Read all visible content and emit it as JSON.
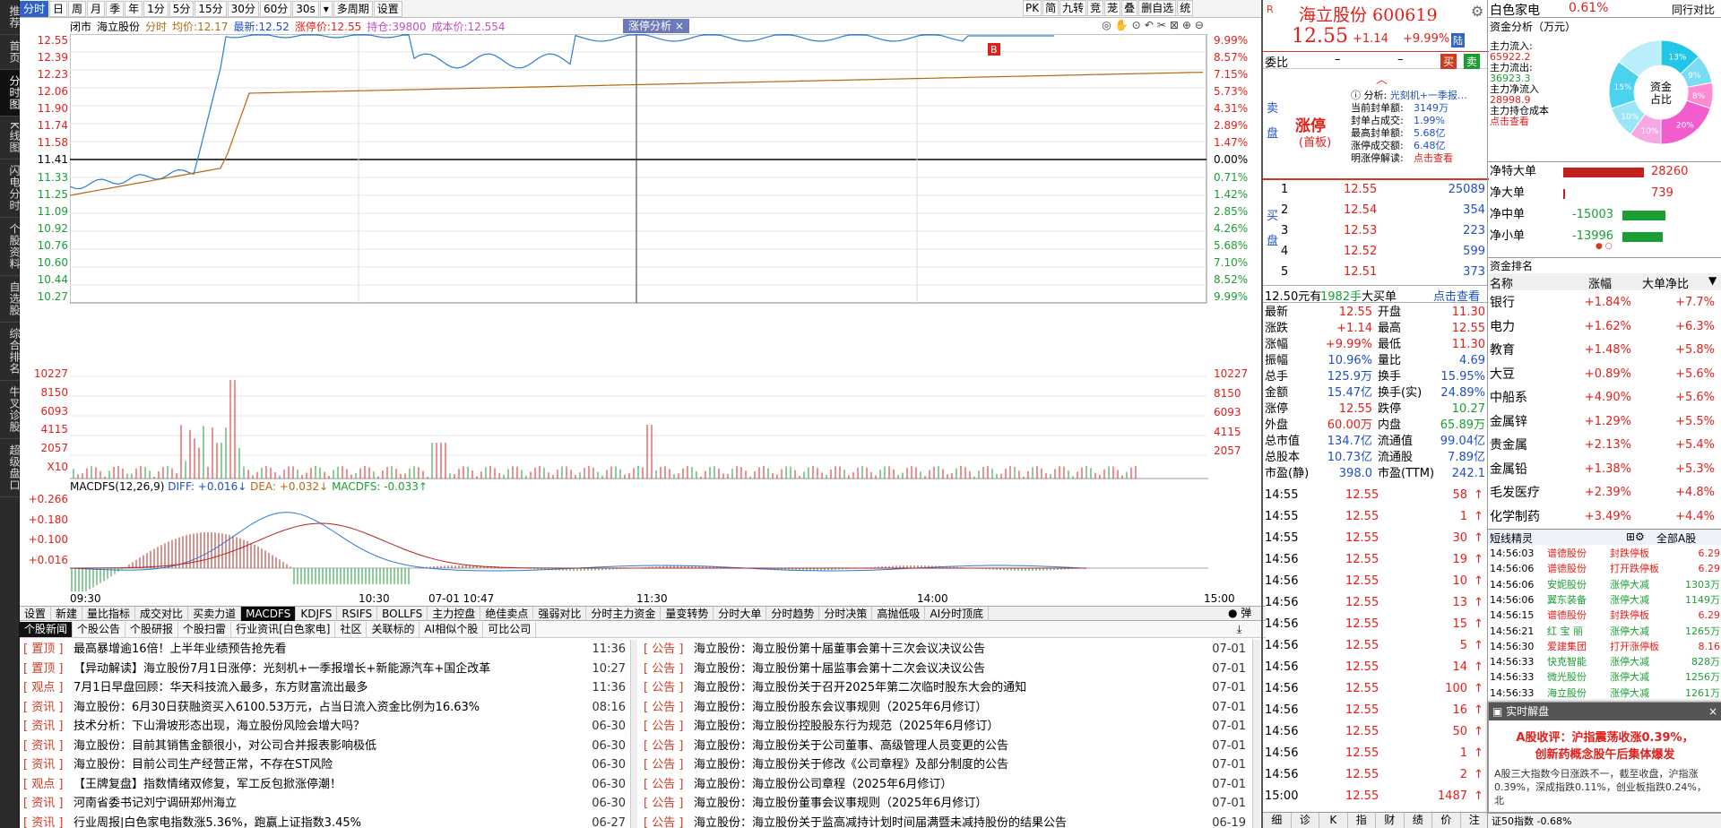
{
  "rail": [
    "推荐",
    "首页",
    "分时图",
    "K线图",
    "闪电分时",
    "个股资料",
    "自选股",
    "综合排名",
    "牛叉诊股",
    "超级盘口"
  ],
  "toolbar": {
    "periods": [
      "分时",
      "日",
      "周",
      "月",
      "季",
      "年",
      "1分",
      "5分",
      "15分",
      "30分",
      "60分",
      "30s"
    ],
    "extra": [
      "多周期",
      "设置"
    ],
    "right": [
      "PK",
      "简",
      "九转",
      "竞",
      "茏",
      "叠",
      "删自选",
      "统"
    ]
  },
  "chart": {
    "status": "闭市",
    "name": "海立股份",
    "time_label": "分时",
    "avg_label": "均价:",
    "avg": "12.17",
    "latest_label": "最新:",
    "latest": "12.52",
    "chg_label": "涨停价:",
    "chg": "12.55",
    "hold_label": "持仓:",
    "hold": "39800",
    "cost_label": "成本价:",
    "cost": "12.554",
    "zt_label": "涨停分析",
    "zt_close": "×",
    "priceAxisL": [
      "12.55",
      "12.39",
      "12.23",
      "12.06",
      "11.90",
      "11.74",
      "11.58",
      "11.41",
      "11.33",
      "11.25",
      "11.09",
      "10.92",
      "10.76",
      "10.60",
      "10.44",
      "10.27"
    ],
    "priceAxisR": [
      "9.99%",
      "8.57%",
      "7.15%",
      "5.73%",
      "4.31%",
      "2.89%",
      "1.47%",
      "0.00%",
      "0.71%",
      "1.42%",
      "2.85%",
      "4.26%",
      "5.68%",
      "7.10%",
      "8.52%",
      "9.99%"
    ],
    "volAxisL": [
      "10227",
      "8150",
      "6093",
      "4115",
      "2057",
      "X10"
    ],
    "volAxisR": [
      "10227",
      "8150",
      "6093",
      "4115",
      "2057"
    ],
    "macd_head": "MACDFS(12,26,9)",
    "diff": "DIFF: +0.016↓",
    "dea": "DEA: +0.032↓",
    "macdfs": "MACDFS: -0.033↑",
    "macdAxis": [
      "+0.266",
      "+0.180",
      "+0.100",
      "+0.016"
    ],
    "timeAxis": [
      "09:30",
      "10:30",
      "07-01 10:47",
      "11:30",
      "14:00",
      "15:00"
    ],
    "marker": "B"
  },
  "indTabs": [
    "设置",
    "新建",
    "量比指标",
    "成交对比",
    "买卖力道",
    "MACDFS",
    "KDJFS",
    "RSIFS",
    "BOLLFS",
    "主力控盘",
    "绝佳卖点",
    "强弱对比",
    "分时主力资金",
    "量变转势",
    "分时大单",
    "分时趋势",
    "分时决策",
    "高抛低吸",
    "AI分时顶底"
  ],
  "indActive": "MACDFS",
  "bullet": "弹",
  "newsTabs": [
    "个股新闻",
    "个股公告",
    "个股研报",
    "个股扫雷",
    "行业资讯[白色家电]",
    "社区",
    "关联标的",
    "AI相似个股",
    "可比公司"
  ],
  "newsLeft": [
    [
      "置顶",
      "最高暴增逾16倍！上半年业绩预告抢先看",
      "11:36"
    ],
    [
      "置顶",
      "【异动解读】海立股份7月1日涨停：光刻机+一季报增长+新能源汽车+国企改革",
      "10:27"
    ],
    [
      "观点",
      "7月1日早盘回顾：华天科技流入最多，东方财富流出最多",
      "11:36"
    ],
    [
      "资讯",
      "海立股份：6月30日获融资买入6100.53万元，占当日流入资金比例为16.63%",
      "08:16"
    ],
    [
      "资讯",
      "技术分析：下山滑坡形态出现，海立股份风险会增大吗？",
      "06-30"
    ],
    [
      "资讯",
      "海立股份：目前其销售金额很小，对公司合并报表影响极低",
      "06-30"
    ],
    [
      "资讯",
      "海立股份：目前公司生产经营正常，不存在ST风险",
      "06-30"
    ],
    [
      "观点",
      "【王牌复盘】指数情绪双修复，军工反包掀涨停潮！",
      "06-30"
    ],
    [
      "资讯",
      "河南省委书记刘宁调研郑州海立",
      "06-30"
    ],
    [
      "资讯",
      "行业周报|白色家电指数涨5.36%，跑赢上证指数3.45%",
      "06-27"
    ]
  ],
  "newsRight": [
    [
      "公告",
      "海立股份：海立股份第十届董事会第十三次会议决议公告",
      "07-01"
    ],
    [
      "公告",
      "海立股份：海立股份第十届监事会第十二次会议决议公告",
      "07-01"
    ],
    [
      "公告",
      "海立股份：海立股份关于召开2025年第二次临时股东大会的通知",
      "07-01"
    ],
    [
      "公告",
      "海立股份：海立股份股东会议事规则（2025年6月修订）",
      "07-01"
    ],
    [
      "公告",
      "海立股份：海立股份控股股东行为规范（2025年6月修订）",
      "07-01"
    ],
    [
      "公告",
      "海立股份：海立股份关于公司董事、高级管理人员变更的公告",
      "07-01"
    ],
    [
      "公告",
      "海立股份：海立股份关于修改《公司章程》及部分制度的公告",
      "07-01"
    ],
    [
      "公告",
      "海立股份：海立股份公司章程（2025年6月修订）",
      "07-01"
    ],
    [
      "公告",
      "海立股份：海立股份董事会议事规则（2025年6月修订）",
      "07-01"
    ],
    [
      "公告",
      "海立股份：海立股份关于监高减持计划时间届满暨未减持股份的结果公告",
      "06-19"
    ]
  ],
  "quote": {
    "title": "海立股份 600619",
    "price": "12.55",
    "change": "+1.14",
    "pct": "+9.99%",
    "tag": "陆",
    "r_tag": "R",
    "weibi_label": "委比",
    "weibi": "–",
    "weibi2": "–",
    "buy": "买",
    "sell": "卖",
    "sell_label": "卖盘",
    "buy_label": "买盘",
    "zhangting": "涨停",
    "shouban": "(首板)",
    "analysis_title": "分析:",
    "analysis": "光刻机+一季报…",
    "analysis_rows": [
      [
        "当前封单额:",
        "3149万"
      ],
      [
        "封单占成交:",
        "1.99%"
      ],
      [
        "最高封单额:",
        "5.68亿"
      ],
      [
        "涨停成交额:",
        "6.48亿"
      ],
      [
        "明涨停解读:",
        "点击查看"
      ]
    ],
    "bids": [
      [
        "1",
        "12.55",
        "25089"
      ],
      [
        "2",
        "12.54",
        "354"
      ],
      [
        "3",
        "12.53",
        "223"
      ],
      [
        "4",
        "12.52",
        "599"
      ],
      [
        "5",
        "12.51",
        "373"
      ]
    ],
    "big": "12.50元有",
    "bigv": "1982手",
    "bigt": "大买单",
    "bigl": "点击查看",
    "stats": [
      [
        "最新",
        "12.55",
        "开盘",
        "11.30"
      ],
      [
        "涨跌",
        "+1.14",
        "最高",
        "12.55"
      ],
      [
        "涨幅",
        "+9.99%",
        "最低",
        "11.30"
      ],
      [
        "振幅",
        "10.96%",
        "量比",
        "4.69"
      ],
      [
        "总手",
        "125.9万",
        "换手",
        "15.95%"
      ],
      [
        "金额",
        "15.47亿",
        "换手(实)",
        "24.89%"
      ],
      [
        "涨停",
        "12.55",
        "跌停",
        "10.27"
      ],
      [
        "外盘",
        "60.00万",
        "内盘",
        "65.89万"
      ],
      [
        "总市值",
        "134.7亿",
        "流通值",
        "99.04亿"
      ],
      [
        "总股本",
        "10.73亿",
        "流通股",
        "7.89亿"
      ],
      [
        "市盈(静)",
        "398.0",
        "市盈(TTM)",
        "242.1"
      ]
    ],
    "ticks": [
      [
        "14:55",
        "12.55",
        "58"
      ],
      [
        "14:55",
        "12.55",
        "1"
      ],
      [
        "14:55",
        "12.55",
        "30"
      ],
      [
        "14:56",
        "12.55",
        "19"
      ],
      [
        "14:56",
        "12.55",
        "10"
      ],
      [
        "14:56",
        "12.55",
        "13"
      ],
      [
        "14:56",
        "12.55",
        "15"
      ],
      [
        "14:56",
        "12.55",
        "5"
      ],
      [
        "14:56",
        "12.55",
        "14"
      ],
      [
        "14:56",
        "12.55",
        "100"
      ],
      [
        "14:56",
        "12.55",
        "16"
      ],
      [
        "14:56",
        "12.55",
        "50"
      ],
      [
        "14:56",
        "12.55",
        "1"
      ],
      [
        "14:56",
        "12.55",
        "2"
      ],
      [
        "15:00",
        "12.55",
        "1487"
      ]
    ],
    "bottom": [
      "细",
      "诊",
      "K",
      "指",
      "财",
      "绩",
      "价",
      "注"
    ]
  },
  "fr": {
    "sector": "白色家电",
    "sector_pct": "0.61%",
    "peer": "同行对比",
    "fund_title": "资金分析（万元）",
    "fund": [
      [
        "主力流入:",
        "65922.2"
      ],
      [
        "主力流出:",
        "36923.3"
      ],
      [
        "主力净流入",
        "28998.9"
      ],
      [
        "主力持仓成本",
        ""
      ],
      [
        "点击查看",
        ""
      ]
    ],
    "pie_center": "资金\n占比",
    "pie_labels": [
      "13%",
      "9%",
      "8%",
      "20%",
      "10%",
      "10%",
      "15%"
    ],
    "net": [
      [
        "净特大单",
        "28260"
      ],
      [
        "净大单",
        "739"
      ],
      [
        "净中单",
        "-15003"
      ],
      [
        "净小单",
        "-13996"
      ]
    ],
    "rank_title": "资金排名",
    "rank_head": [
      "名称",
      "涨幅",
      "大单净比"
    ],
    "rank": [
      [
        "银行",
        "+1.84%",
        "+7.7%"
      ],
      [
        "电力",
        "+1.62%",
        "+6.3%"
      ],
      [
        "教育",
        "+1.48%",
        "+5.8%"
      ],
      [
        "大豆",
        "+0.89%",
        "+5.6%"
      ],
      [
        "中船系",
        "+4.90%",
        "+5.6%"
      ],
      [
        "金属锌",
        "+1.29%",
        "+5.5%"
      ],
      [
        "贵金属",
        "+2.13%",
        "+5.4%"
      ],
      [
        "金属铅",
        "+1.38%",
        "+5.3%"
      ],
      [
        "毛发医疗",
        "+2.39%",
        "+4.8%"
      ],
      [
        "化学制药",
        "+3.49%",
        "+4.4%"
      ]
    ],
    "wizard_title": "短线精灵",
    "wizard_scope": "全部A股",
    "wizard": [
      [
        "14:56:03",
        "谱德股份",
        "封跌停板",
        "6.29"
      ],
      [
        "14:56:06",
        "谱德股份",
        "打开跌停板",
        "6.29"
      ],
      [
        "14:56:06",
        "安妮股份",
        "涨停大减",
        "1303万"
      ],
      [
        "14:56:06",
        "翼东装备",
        "涨停大减",
        "1149万"
      ],
      [
        "14:56:15",
        "谱德股份",
        "封跌停板",
        "6.29"
      ],
      [
        "14:56:21",
        "红 宝 丽",
        "涨停大减",
        "1265万"
      ],
      [
        "14:56:30",
        "爱建集团",
        "打开涨停板",
        "8.16"
      ],
      [
        "14:56:33",
        "快克智能",
        "涨停大减",
        "828万"
      ],
      [
        "14:56:33",
        "微光股份",
        "涨停大减",
        "1256万"
      ],
      [
        "14:56:33",
        "海立股份",
        "涨停大减",
        "1261万"
      ]
    ],
    "pop_title": "实时解盘",
    "pop_line1": "A股收评：沪指震荡收涨0.39%，",
    "pop_line2": "创新药概念股午后集体爆发",
    "pop_body": "A股三大指数今日涨跌不一，截至收盘，沪指涨0.39%，深成指跌0.11%，创业板指跌0.24%，北",
    "status": "证50指数 -0.68%"
  }
}
